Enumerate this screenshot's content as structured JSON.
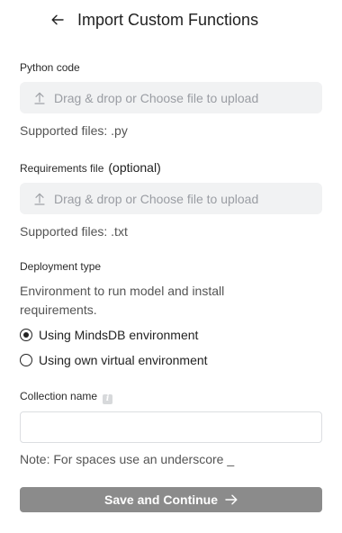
{
  "header": {
    "title": "Import Custom Functions",
    "back_icon": "arrow-left-icon"
  },
  "python_code": {
    "label": "Python code",
    "dropzone_text": "Drag & drop or Choose file to upload",
    "supported": "Supported files: .py"
  },
  "requirements": {
    "label": "Requirements file",
    "optional": "(optional)",
    "dropzone_text": "Drag & drop or Choose file to upload",
    "supported": "Supported files: .txt"
  },
  "deployment": {
    "label": "Deployment type",
    "description": "Environment to run model and install requirements.",
    "options": [
      {
        "label": "Using MindsDB environment",
        "selected": true
      },
      {
        "label": "Using own virtual environment",
        "selected": false
      }
    ]
  },
  "collection": {
    "label": "Collection name",
    "info_icon": "info-icon",
    "value": "",
    "placeholder": "",
    "note": "Note: For spaces use an underscore _"
  },
  "submit": {
    "label": "Save and Continue",
    "icon": "arrow-right-icon"
  },
  "colors": {
    "button_bg": "#8b8b8b",
    "dropzone_bg": "#f1f2f3",
    "text_muted": "#545454"
  }
}
